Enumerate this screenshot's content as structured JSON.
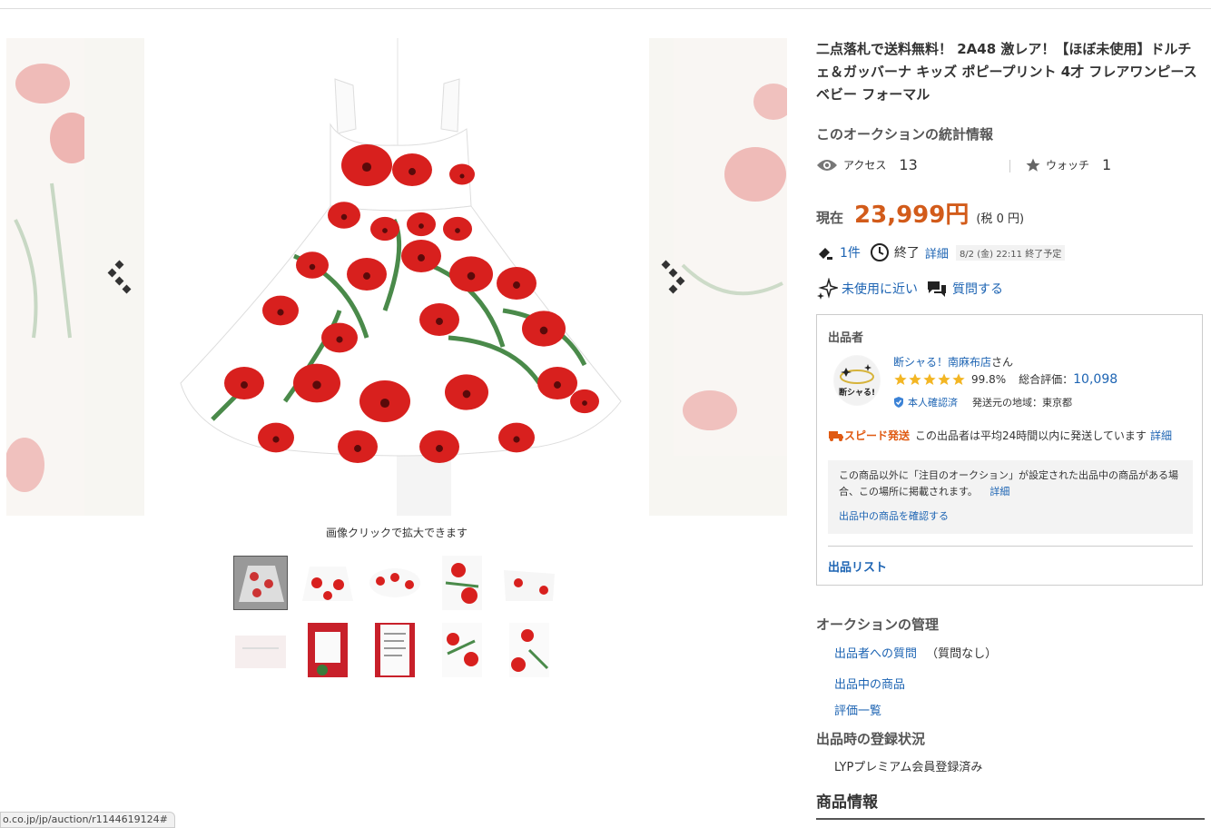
{
  "gallery": {
    "caption": "画像クリックで拡大できます",
    "prev_icon": "chevron-left-icon",
    "next_icon": "chevron-right-icon",
    "thumbnail_count": 10
  },
  "status_url": "o.co.jp/jp/auction/r1144619124#",
  "item": {
    "title": "二点落札で送料無料！ 2A48 激レア！【ほぼ未使用】ドルチェ＆ガッバーナ キッズ ポピープリント 4才 フレアワンピース ベビー フォーマル"
  },
  "stats": {
    "heading": "このオークションの統計情報",
    "access_label": "アクセス",
    "access_count": "13",
    "watch_label": "ウォッチ",
    "watch_count": "1"
  },
  "price": {
    "label": "現在",
    "value": "23,999円",
    "tax": "(税 0 円)"
  },
  "bids": {
    "count": "1件",
    "end_label": "終了",
    "detail_link": "詳細",
    "end_time": "8/2 (金) 22:11 終了予定"
  },
  "condition": {
    "label": "未使用に近い",
    "question_link": "質問する"
  },
  "seller": {
    "heading": "出品者",
    "avatar_text": "断シャる!",
    "name": "断シャる！南麻布店",
    "name_suffix": "さん",
    "rating_percent": "99.8%",
    "total_label": "総合評価：",
    "total_value": "10,098",
    "verified_label": "本人確認済",
    "region_label": "発送元の地域：東京都",
    "speed_label": "スピード発送",
    "speed_text": "この出品者は平均24時間以内に発送しています",
    "speed_detail": "詳細",
    "notice_text": "この商品以外に「注目のオークション」が設定された出品中の商品がある場合、この場所に掲載されます。",
    "notice_detail": "詳細",
    "notice_link": "出品中の商品を確認する",
    "list_link": "出品リスト"
  },
  "management": {
    "heading": "オークションの管理",
    "question_link": "出品者への質問",
    "question_note": "（質問なし）",
    "listings_link": "出品中の商品",
    "reviews_link": "評価一覧"
  },
  "registration": {
    "heading": "出品時の登録状況",
    "status": "LYPプレミアム会員登録済み"
  },
  "product_info": {
    "heading": "商品情報"
  },
  "colors": {
    "accent_price": "#d25b1a",
    "link": "#1d64b3",
    "speed": "#e05a12",
    "poppy_red": "#d8201e",
    "leaf_green": "#4a8a4a"
  }
}
